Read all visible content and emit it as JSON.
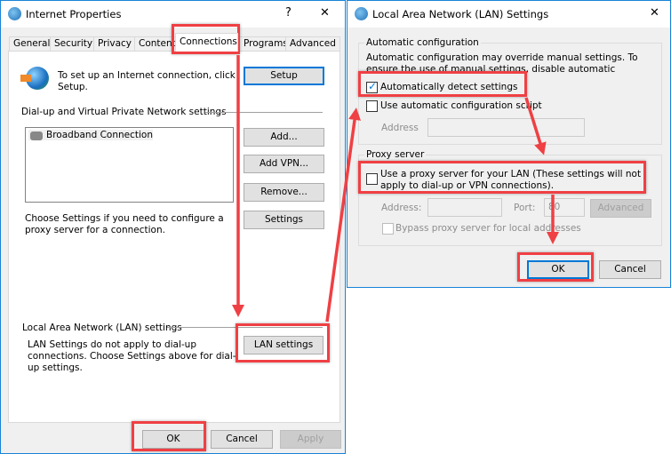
{
  "left": {
    "title": "Internet Properties",
    "help": "?",
    "close": "✕",
    "tabs": [
      "General",
      "Security",
      "Privacy",
      "Content",
      "Connections",
      "Programs",
      "Advanced"
    ],
    "setup_text": "To set up an Internet connection, click Setup.",
    "setup_btn": "Setup",
    "dialup_header": "Dial-up and Virtual Private Network settings",
    "connections": [
      "Broadband Connection"
    ],
    "add_btn": "Add...",
    "addvpn_btn": "Add VPN...",
    "remove_btn": "Remove...",
    "settings_btn": "Settings",
    "proxy_text": "Choose Settings if you need to configure a proxy server for a connection.",
    "lan_header": "Local Area Network (LAN) settings",
    "lan_text": "LAN Settings do not apply to dial-up connections. Choose Settings above for dial-up settings.",
    "lan_btn": "LAN settings",
    "ok": "OK",
    "cancel": "Cancel",
    "apply": "Apply"
  },
  "right": {
    "title": "Local Area Network (LAN) Settings",
    "close": "✕",
    "auto_group": "Automatic configuration",
    "auto_text": "Automatic configuration may override manual settings.  To ensure the use of manual settings, disable automatic configuration.",
    "auto_detect": {
      "label": "Automatically detect settings",
      "checked": true
    },
    "auto_script": {
      "label": "Use automatic configuration script",
      "checked": false
    },
    "address_label": "Address",
    "proxy_group": "Proxy server",
    "use_proxy": {
      "label": "Use a proxy server for your LAN (These settings will not apply to dial-up or VPN connections).",
      "checked": false
    },
    "proxy_address_label": "Address:",
    "port_label": "Port:",
    "port_value": "80",
    "advanced_btn": "Advanced",
    "bypass": {
      "label": "Bypass proxy server for local addresses",
      "checked": false
    },
    "ok": "OK",
    "cancel": "Cancel"
  },
  "colors": {
    "highlight": "#ef4044",
    "accent": "#0078d7"
  }
}
